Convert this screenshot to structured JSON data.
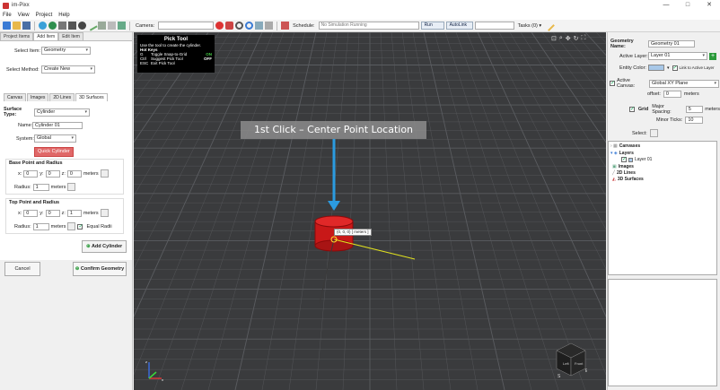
{
  "window": {
    "title": "im-Pixx",
    "minimize": "—",
    "maximize": "□",
    "close": "✕"
  },
  "menu": [
    "File",
    "View",
    "Project",
    "Help"
  ],
  "toolbar": {
    "camera_label": "Camera:",
    "schedule_label": "Schedule:",
    "schedule_value": "No Simulation Running",
    "run_label": "Run",
    "autolink_label": "AutoLink",
    "tasks_label": "Tasks (0) ▾"
  },
  "left_panel": {
    "tabs": [
      "Project Items",
      "Add Item",
      "Edit Item"
    ],
    "active_tab": "Add Item",
    "select_item_label": "Select Item:",
    "select_item_value": "Geometry",
    "select_method_label": "Select Method:",
    "select_method_value": "Create New",
    "subtabs": [
      "Canvas",
      "Images",
      "2D Lines",
      "3D Surfaces"
    ],
    "active_subtab": "3D Surfaces",
    "surface_type_label": "Surface Type:",
    "surface_type_value": "Cylinder",
    "name_label": "Name:",
    "name_value": "Cylinder 01",
    "system_label": "System:",
    "system_value": "Global",
    "quick_cylinder": "Quick Cylinder",
    "base": {
      "title": "Base Point and Radius",
      "x_label": "x:",
      "x": "0",
      "y_label": "y:",
      "y": "0",
      "z_label": "z:",
      "z": "0",
      "units": "meters",
      "radius_label": "Radius:",
      "radius": "1",
      "radius_units": "meters"
    },
    "top": {
      "title": "Top Point and Radius",
      "x_label": "x:",
      "x": "0",
      "y_label": "y:",
      "y": "0",
      "z_label": "z:",
      "z": "1",
      "units": "meters",
      "radius_label": "Radius:",
      "radius": "1",
      "radius_units": "meters",
      "equal_radii": "Equal Radii"
    },
    "add_cylinder": "Add Cylinder",
    "cancel": "Cancel",
    "confirm": "Confirm Geometry"
  },
  "pick_tool": {
    "title": "Pick Tool",
    "desc": "Use the tool to create the cylinder.",
    "hotkeys_title": "Hot Keys",
    "rows": [
      {
        "key": "G",
        "desc": "Toggle Snap-to-Grid",
        "state": "ON"
      },
      {
        "key": "Ctrl",
        "desc": "Suggest Pick Tool",
        "state": "OFF"
      },
      {
        "key": "ESC",
        "desc": "Exit Pick Tool",
        "state": ""
      }
    ]
  },
  "viewport": {
    "callout": "1st Click – Center Point Location",
    "coord_label": "(0, 0, 0)  [ meters ]",
    "cube_front": "Front",
    "cube_left": "Left",
    "cube_east": "E",
    "cube_south": "S",
    "axis_z": "z",
    "axis_x": "x"
  },
  "right_panel": {
    "geometry_name_label": "Geometry Name:",
    "geometry_name_value": "Geometry 01",
    "active_layer_label": "Active Layer:",
    "active_layer_value": "Layer 01",
    "entity_color_label": "Entity Color:",
    "link_label": "Link to Active Layer",
    "active_canvas_label": "Active Canvas:",
    "active_canvas_value": "Global XY Plane",
    "offset_label": "offset:",
    "offset_value": "0",
    "offset_units": "meters",
    "grid_label": "Grid",
    "major_spacing_label": "Major Spacing:",
    "major_spacing_value": "5",
    "major_spacing_units": "meters",
    "minor_ticks_label": "Minor Ticks:",
    "minor_ticks_value": "10",
    "select_label": "Select:",
    "tree": {
      "canvases": "Canvases",
      "layers": "Layers",
      "layer01": "Layer 01",
      "images": "Images",
      "lines2d": "2D Lines",
      "surfaces3d": "3D Surfaces"
    }
  },
  "colors": {
    "accent_red": "#e06868",
    "callout_arrow": "#2b9be0",
    "cylinder": "#c81818",
    "grid_line": "#5a5c60"
  }
}
